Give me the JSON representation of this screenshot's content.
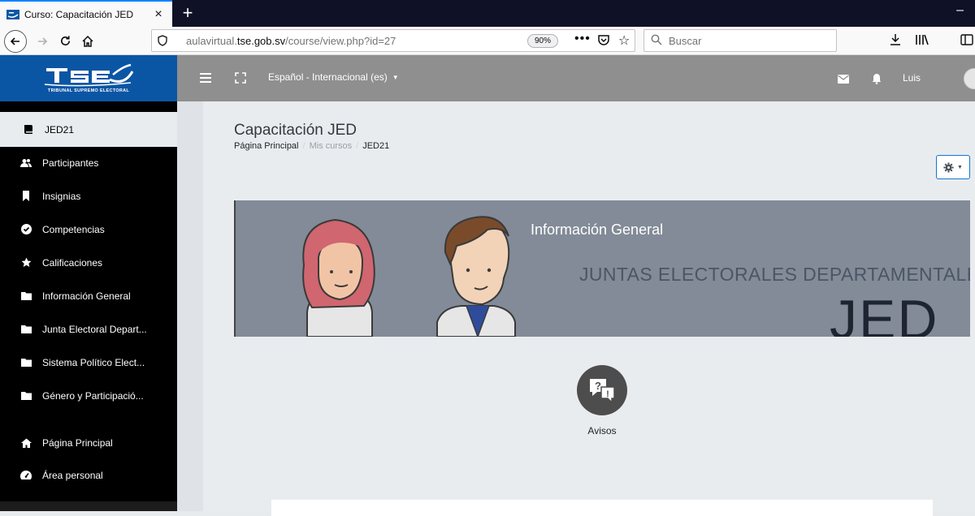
{
  "browser": {
    "tab_title": "Curso: Capacitación JED",
    "tab_close": "×",
    "new_tab": "+",
    "window_minimize": "–",
    "url_prefix": "aulavirtual.",
    "url_host": "tse.gob.sv",
    "url_path": "/course/view.php?id=27",
    "zoom": "90%",
    "page_actions": "•••",
    "bookmark_star": "☆",
    "search_placeholder": "Buscar"
  },
  "header": {
    "logo_caption": "TRIBUNAL SUPREMO ELECTORAL",
    "language": "Español - Internacional (es)",
    "language_caret": "▼",
    "user_name": "Luis",
    "header_bg": "#8f8f8f",
    "logo_bg": "#0b56a4"
  },
  "sidebar": {
    "items": [
      {
        "label": "JED21",
        "icon": "book-icon",
        "active": true
      },
      {
        "label": "Participantes",
        "icon": "users-icon"
      },
      {
        "label": "Insignias",
        "icon": "bookmark-icon"
      },
      {
        "label": "Competencias",
        "icon": "check-circle-icon"
      },
      {
        "label": "Calificaciones",
        "icon": "star-icon"
      },
      {
        "label": "Información General",
        "icon": "folder-icon"
      },
      {
        "label": "Junta Electoral Depart...",
        "icon": "folder-icon"
      },
      {
        "label": "Sistema Político Elect...",
        "icon": "folder-icon"
      },
      {
        "label": "Género y Participació...",
        "icon": "folder-icon"
      },
      {
        "label": "Página Principal",
        "icon": "home-icon"
      },
      {
        "label": "Área personal",
        "icon": "dashboard-icon"
      }
    ]
  },
  "main": {
    "course_title": "Capacitación JED",
    "breadcrumb": [
      "Página Principal",
      "Mis cursos",
      "JED21"
    ],
    "breadcrumb_separator": "/",
    "gear_caret": "▼",
    "banner": {
      "title": "Información General",
      "subtitle": "JUNTAS ELECTORALES DEPARTAMENTALES",
      "big_text": "JED"
    },
    "activity": {
      "label": "Avisos",
      "icon_glyph_q": "?",
      "icon_glyph_excl": "!"
    }
  }
}
